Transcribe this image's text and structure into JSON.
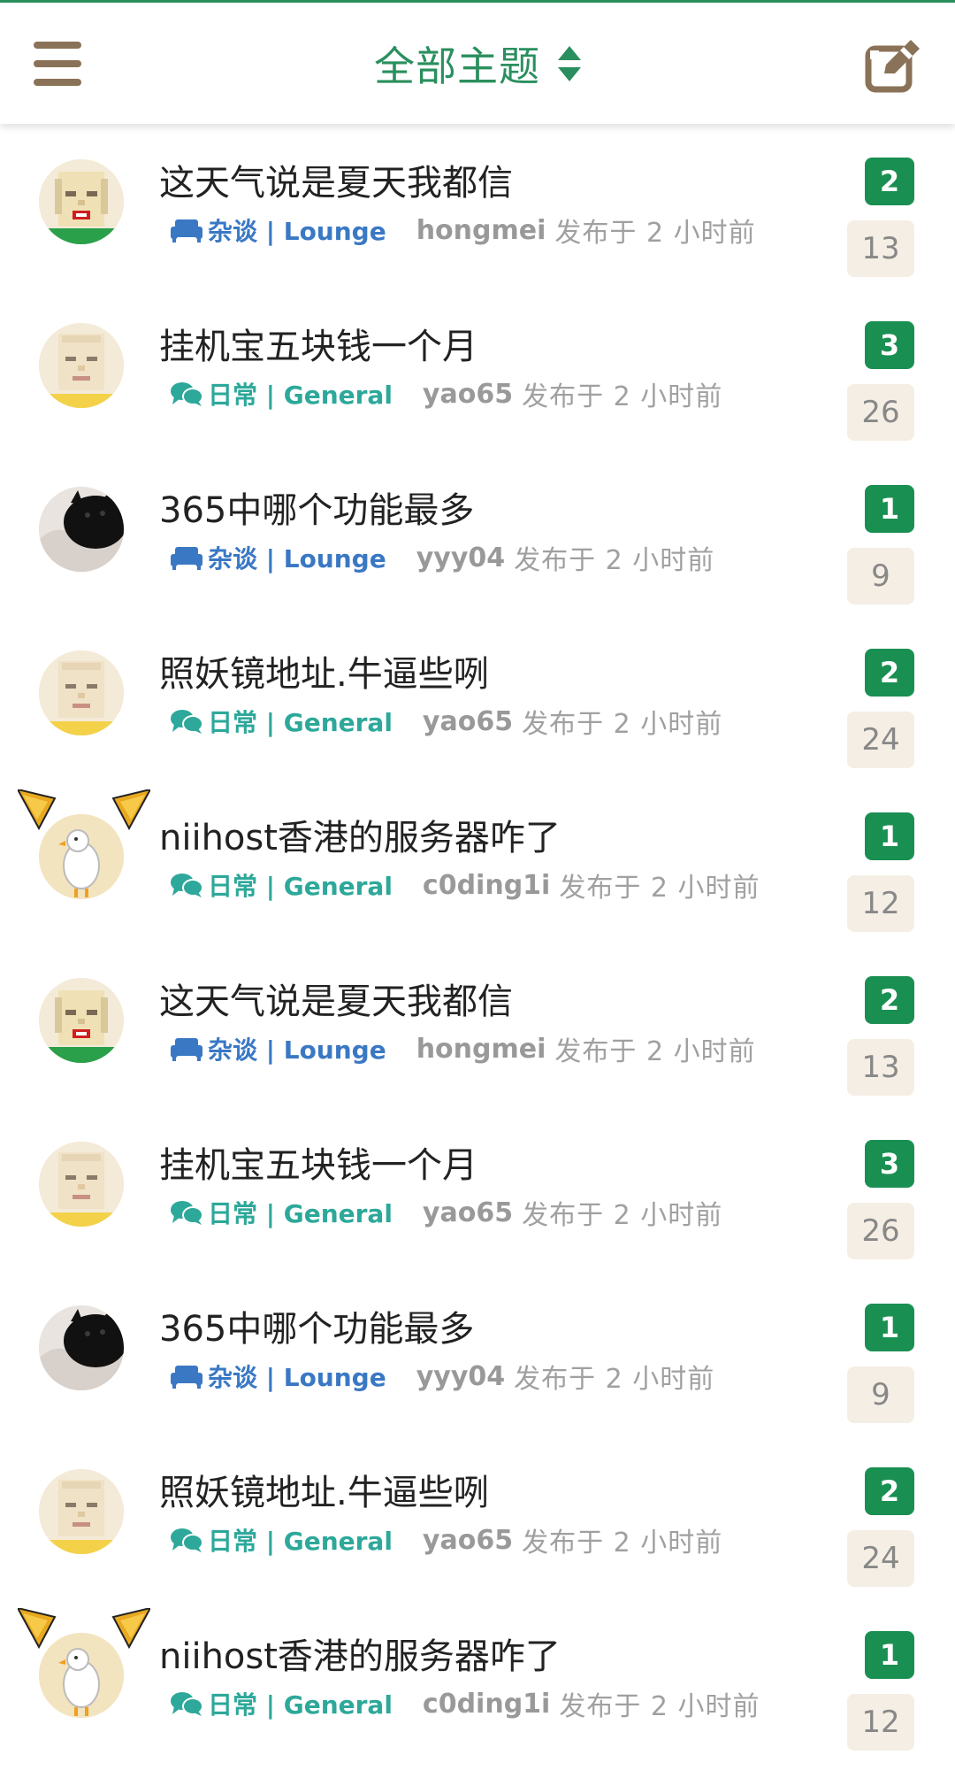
{
  "header": {
    "title": "全部主题",
    "menu_icon": "hamburger-menu-icon",
    "sort_icon": "sort-updown-icon",
    "compose_icon": "compose-edit-icon"
  },
  "colors": {
    "accent": "#2a8f5e",
    "lounge": "#3a78c4",
    "general": "#2da89a",
    "reply_badge": "#1a8f52",
    "view_badge_bg": "#f5eee4",
    "menu_icon": "#8a7258"
  },
  "topics": [
    {
      "title": "这天气说是夏天我都信",
      "category": "杂谈 | Lounge",
      "category_type": "lounge",
      "category_icon": "sofa-icon",
      "author": "hongmei",
      "posted": "发布于 2 小时前",
      "replies": "2",
      "views": "13",
      "avatar": "pixel-face-red-lips"
    },
    {
      "title": "挂机宝五块钱一个月",
      "category": "日常 | General",
      "category_type": "general",
      "category_icon": "chat-bubbles-icon",
      "author": "yao65",
      "posted": "发布于 2 小时前",
      "replies": "3",
      "views": "26",
      "avatar": "pixel-face-pale"
    },
    {
      "title": "365中哪个功能最多",
      "category": "杂谈 | Lounge",
      "category_type": "lounge",
      "category_icon": "sofa-icon",
      "author": "yyy04",
      "posted": "发布于 2 小时前",
      "replies": "1",
      "views": "9",
      "avatar": "photo-black-cat"
    },
    {
      "title": "照妖镜地址.牛逼些咧",
      "category": "日常 | General",
      "category_type": "general",
      "category_icon": "chat-bubbles-icon",
      "author": "yao65",
      "posted": "发布于 2 小时前",
      "replies": "2",
      "views": "24",
      "avatar": "pixel-face-pale"
    },
    {
      "title": "niihost香港的服务器咋了",
      "category": "日常 | General",
      "category_type": "general",
      "category_icon": "chat-bubbles-icon",
      "author": "c0ding1i",
      "posted": "发布于 2 小时前",
      "replies": "1",
      "views": "12",
      "avatar": "cartoon-duck-fox-ears"
    },
    {
      "title": "这天气说是夏天我都信",
      "category": "杂谈 | Lounge",
      "category_type": "lounge",
      "category_icon": "sofa-icon",
      "author": "hongmei",
      "posted": "发布于 2 小时前",
      "replies": "2",
      "views": "13",
      "avatar": "pixel-face-red-lips"
    },
    {
      "title": "挂机宝五块钱一个月",
      "category": "日常 | General",
      "category_type": "general",
      "category_icon": "chat-bubbles-icon",
      "author": "yao65",
      "posted": "发布于 2 小时前",
      "replies": "3",
      "views": "26",
      "avatar": "pixel-face-pale"
    },
    {
      "title": "365中哪个功能最多",
      "category": "杂谈 | Lounge",
      "category_type": "lounge",
      "category_icon": "sofa-icon",
      "author": "yyy04",
      "posted": "发布于 2 小时前",
      "replies": "1",
      "views": "9",
      "avatar": "photo-black-cat"
    },
    {
      "title": "照妖镜地址.牛逼些咧",
      "category": "日常 | General",
      "category_type": "general",
      "category_icon": "chat-bubbles-icon",
      "author": "yao65",
      "posted": "发布于 2 小时前",
      "replies": "2",
      "views": "24",
      "avatar": "pixel-face-pale"
    },
    {
      "title": "niihost香港的服务器咋了",
      "category": "日常 | General",
      "category_type": "general",
      "category_icon": "chat-bubbles-icon",
      "author": "c0ding1i",
      "posted": "发布于 2 小时前",
      "replies": "1",
      "views": "12",
      "avatar": "cartoon-duck-fox-ears"
    }
  ]
}
